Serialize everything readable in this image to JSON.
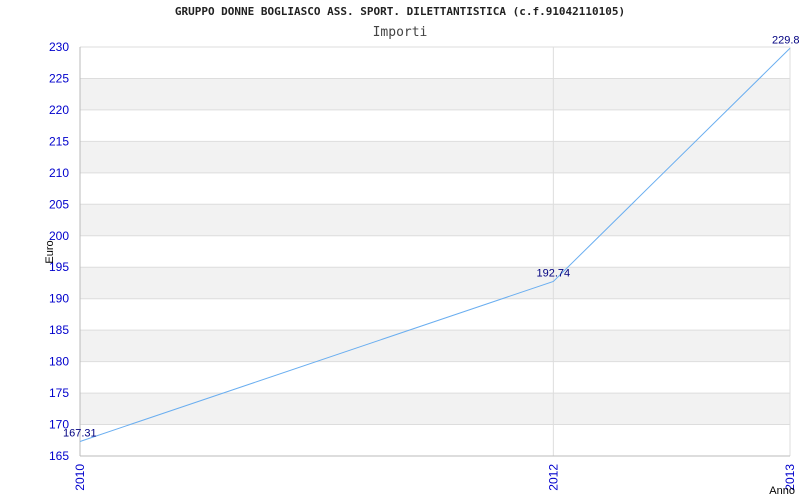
{
  "chart_data": {
    "type": "line",
    "title": "GRUPPO DONNE BOGLIASCO ASS. SPORT. DILETTANTISTICA (c.f.91042110105)",
    "subtitle": "Importi",
    "xlabel": "Anno",
    "ylabel": "Euro",
    "categories": [
      "2010",
      "2012",
      "2013"
    ],
    "series": [
      {
        "values": [
          167.31,
          192.74,
          229.8
        ],
        "labels": [
          "167.31",
          "192.74",
          "229.8"
        ]
      }
    ],
    "ylim": [
      165,
      230
    ],
    "ytick_step": 5,
    "grid": "horizontal-bands",
    "colors": {
      "line": "#6aaef0",
      "tick_text": "#0000cc",
      "label_text": "#000080",
      "band": "#f2f2f2",
      "gridline": "#dddddd"
    }
  }
}
